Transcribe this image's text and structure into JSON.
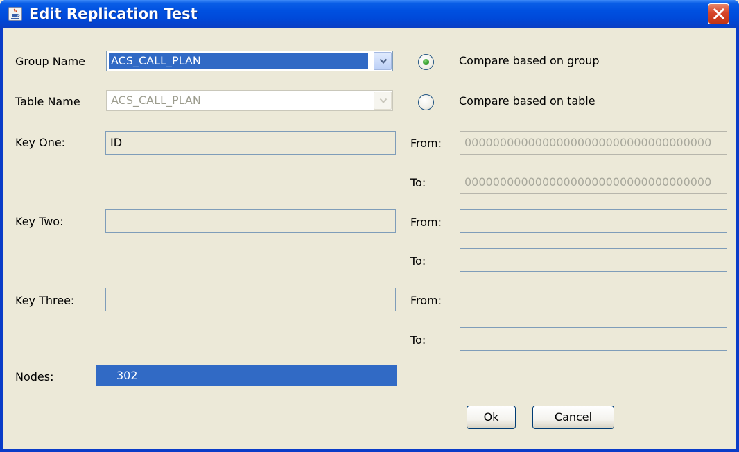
{
  "window": {
    "title": "Edit Replication Test"
  },
  "form": {
    "group_name_label": "Group Name",
    "group_name_value": "ACS_CALL_PLAN",
    "table_name_label": "Table Name",
    "table_name_value": "ACS_CALL_PLAN",
    "radio_group_label": "Compare based on group",
    "radio_table_label": "Compare based on table",
    "selected_compare_mode": "group",
    "key_one_label": "Key One:",
    "key_one_value": "ID",
    "key_one_from_label": "From:",
    "key_one_from_value": "00000000000000000000000000000000000",
    "key_one_to_label": "To:",
    "key_one_to_value": "00000000000000000000000000000000000",
    "key_two_label": "Key Two:",
    "key_two_value": "",
    "key_two_from_label": "From:",
    "key_two_from_value": "",
    "key_two_to_label": "To:",
    "key_two_to_value": "",
    "key_three_label": "Key Three:",
    "key_three_value": "",
    "key_three_from_label": "From:",
    "key_three_from_value": "",
    "key_three_to_label": "To:",
    "key_three_to_value": "",
    "nodes_label": "Nodes:",
    "nodes_value": "302"
  },
  "buttons": {
    "ok_label": "Ok",
    "cancel_label": "Cancel"
  },
  "icons": {
    "app": "java-coffee-cup-icon",
    "close": "close-icon",
    "dropdown": "chevron-down-icon"
  },
  "colors": {
    "titlebar": "#0050e0",
    "selection": "#316ac5",
    "dialog_bg": "#ece9d8",
    "close_button": "#d6452a"
  }
}
